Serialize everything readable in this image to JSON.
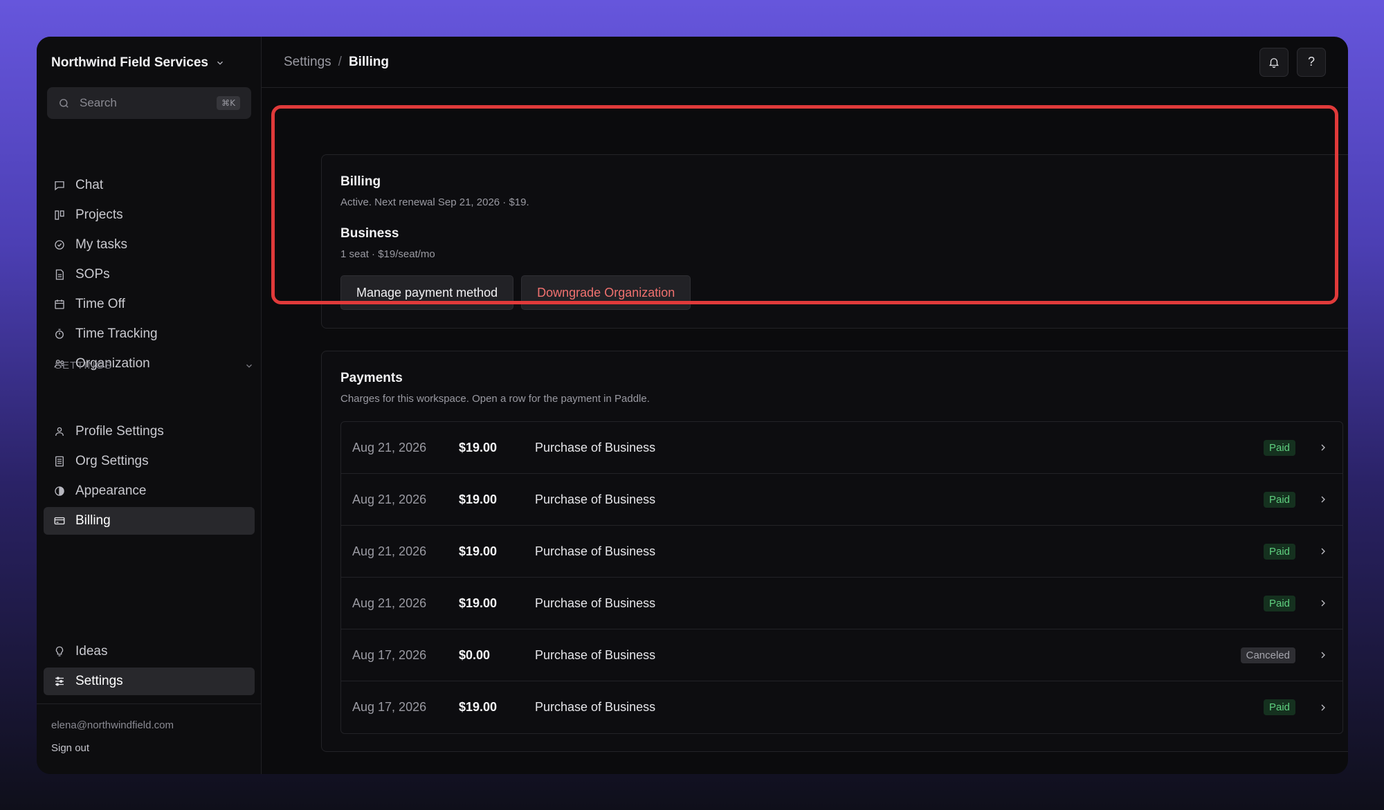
{
  "sidebar": {
    "org_name": "Northwind Field Services",
    "search_placeholder": "Search",
    "search_shortcut": "⌘K",
    "nav": [
      {
        "label": "Chat",
        "icon": "chat-icon"
      },
      {
        "label": "Projects",
        "icon": "projects-icon"
      },
      {
        "label": "My tasks",
        "icon": "check-circle-icon"
      },
      {
        "label": "SOPs",
        "icon": "document-icon"
      },
      {
        "label": "Time Off",
        "icon": "calendar-icon"
      },
      {
        "label": "Time Tracking",
        "icon": "stopwatch-icon"
      },
      {
        "label": "Organization",
        "icon": "users-icon"
      }
    ],
    "settings_section": "SETTINGS",
    "settings_nav": [
      {
        "label": "Profile Settings",
        "icon": "user-icon"
      },
      {
        "label": "Org Settings",
        "icon": "list-icon"
      },
      {
        "label": "Appearance",
        "icon": "contrast-icon"
      },
      {
        "label": "Billing",
        "icon": "credit-card-icon",
        "active": true
      }
    ],
    "bottom_nav": [
      {
        "label": "Ideas",
        "icon": "lightbulb-icon"
      },
      {
        "label": "Settings",
        "icon": "sliders-icon",
        "active": true
      }
    ],
    "user_email": "elena@northwindfield.com",
    "sign_out": "Sign out"
  },
  "header": {
    "breadcrumb_parent": "Settings",
    "breadcrumb_separator": "/",
    "breadcrumb_current": "Billing",
    "help_label": "?"
  },
  "billing": {
    "title": "Billing",
    "status": "Active. Next renewal Sep 21, 2026 · $19.",
    "plan_name": "Business",
    "plan_details": "1 seat · $19/seat/mo",
    "manage_button": "Manage payment method",
    "downgrade_button": "Downgrade Organization"
  },
  "payments": {
    "title": "Payments",
    "subtitle": "Charges for this workspace. Open a row for the payment in Paddle.",
    "rows": [
      {
        "date": "Aug 21, 2026",
        "amount": "$19.00",
        "description": "Purchase of Business",
        "status": "Paid"
      },
      {
        "date": "Aug 21, 2026",
        "amount": "$19.00",
        "description": "Purchase of Business",
        "status": "Paid"
      },
      {
        "date": "Aug 21, 2026",
        "amount": "$19.00",
        "description": "Purchase of Business",
        "status": "Paid"
      },
      {
        "date": "Aug 21, 2026",
        "amount": "$19.00",
        "description": "Purchase of Business",
        "status": "Paid"
      },
      {
        "date": "Aug 17, 2026",
        "amount": "$0.00",
        "description": "Purchase of Business",
        "status": "Canceled"
      },
      {
        "date": "Aug 17, 2026",
        "amount": "$19.00",
        "description": "Purchase of Business",
        "status": "Paid"
      }
    ]
  },
  "colors": {
    "highlight": "#e03a3a",
    "paid": "#5fcf7f",
    "danger": "#f0716f"
  }
}
